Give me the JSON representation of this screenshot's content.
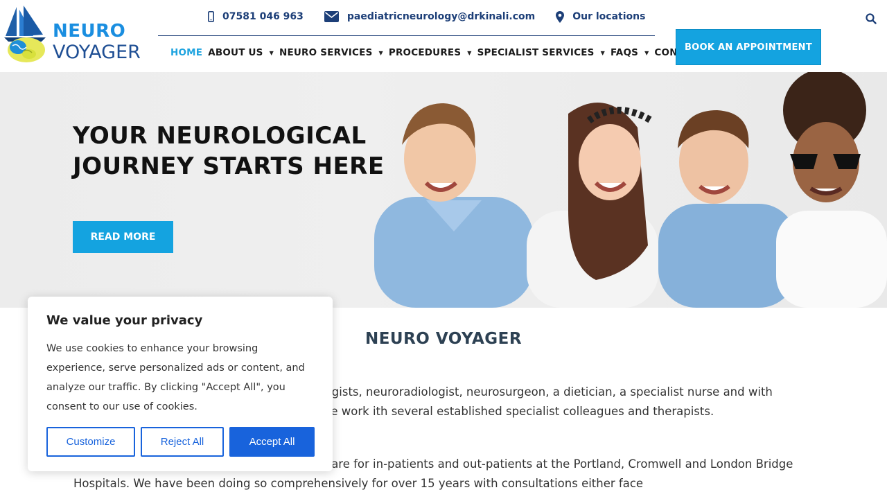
{
  "brand": {
    "line1": "NEURO",
    "line2": "VOYAGER"
  },
  "contact": {
    "phone": "07581 046 963",
    "email": "paediatricneurology@drkinali.com",
    "locations": "Our locations"
  },
  "nav": {
    "items": [
      {
        "label": "HOME",
        "active": true,
        "dropdown": false
      },
      {
        "label": "ABOUT US",
        "dropdown": true
      },
      {
        "label": "NEURO SERVICES",
        "dropdown": true
      },
      {
        "label": "PROCEDURES",
        "dropdown": true
      },
      {
        "label": "SPECIALIST SERVICES",
        "dropdown": true
      },
      {
        "label": "FAQS",
        "dropdown": true
      },
      {
        "label": "CONTACT",
        "dropdown": true
      }
    ],
    "book_label": "BOOK AN APPOINTMENT"
  },
  "hero": {
    "title_line1": "YOUR NEUROLOGICAL",
    "title_line2": "JOURNEY STARTS HERE",
    "button": "READ MORE"
  },
  "content": {
    "title": "NEURO VOYAGER",
    "para1": "n comprising of; paediatric and adult neurologists, neuroradiologist, neurosurgeon, a dietician, a specialist nurse and with excellent administrative support provided. We work ith several established specialist colleagues and therapists.",
    "para2": "atric neurology, and young adult neurology care for in-patients and out-patients at the Portland, Cromwell and London Bridge Hospitals. We have been doing so comprehensively for over 15 years with consultations either face"
  },
  "cookie": {
    "title": "We value your privacy",
    "text": "We use cookies to enhance your browsing experience, serve personalized ads or content, and analyze our traffic. By clicking \"Accept All\", you consent to our use of cookies.",
    "customize": "Customize",
    "reject": "Reject All",
    "accept": "Accept All"
  },
  "colors": {
    "accent": "#14a3e0",
    "navy": "#1d3f78",
    "cookie_blue": "#1863dc"
  }
}
